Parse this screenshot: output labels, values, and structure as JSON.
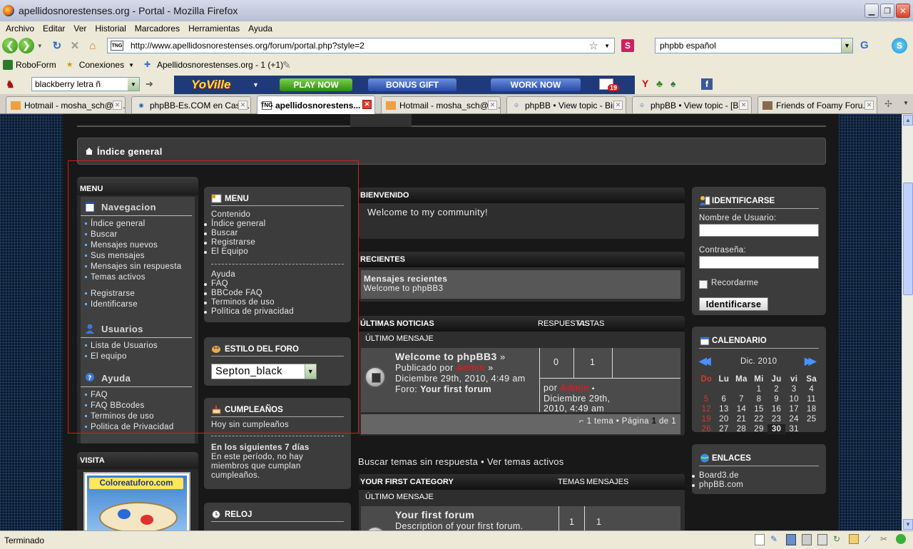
{
  "window": {
    "title": "apellidosnorestenses.org - Portal - Mozilla Firefox"
  },
  "menubar": [
    "Archivo",
    "Editar",
    "Ver",
    "Historial",
    "Marcadores",
    "Herramientas",
    "Ayuda"
  ],
  "navbar": {
    "url": "http://www.apellidosnorestenses.org/forum/portal.php?style=2",
    "url_favicon_text": "TNG",
    "search_value": "phpbb español"
  },
  "bookmarks": [
    {
      "label": "RoboForm",
      "icon": "roboform-icon"
    },
    {
      "label": "Conexiones",
      "icon": "star-icon"
    },
    {
      "label": "Apellidosnorestenses.org - 1 (+1)",
      "icon": "rss-icon"
    }
  ],
  "toolbar3": {
    "search_value": "blackberry letra ñ",
    "yoville_logo": "YoVille",
    "buttons": [
      "PLAY NOW",
      "BONUS GIFT",
      "WORK NOW"
    ],
    "mail_count": "19"
  },
  "tabs": [
    {
      "label": "Hotmail - mosha_sch@h...",
      "active": false
    },
    {
      "label": "phpBB-Es.COM en Cast...",
      "active": false
    },
    {
      "label": "apellidosnorestens...",
      "active": true
    },
    {
      "label": "Hotmail - mosha_sch@h...",
      "active": false
    },
    {
      "label": "phpBB • View topic - Bir...",
      "active": false
    },
    {
      "label": "phpBB • View topic - [B...",
      "active": false
    },
    {
      "label": "Friends of Foamy Foru...",
      "active": false
    }
  ],
  "statusbar": {
    "text": "Terminado"
  },
  "forum": {
    "breadcrumb": "Índice general",
    "left_menu": {
      "header": "MENU",
      "navegacion": {
        "title": "Navegacion",
        "items": [
          "Índice general",
          "Buscar",
          "Mensajes nuevos",
          "Sus mensajes",
          "Mensajes sin respuesta",
          "Temas activos"
        ],
        "items2": [
          "Registrarse",
          "Identificarse"
        ]
      },
      "usuarios": {
        "title": "Usuarios",
        "items": [
          "Lista de Usuarios",
          "El equipo"
        ]
      },
      "ayuda": {
        "title": "Ayuda",
        "items": [
          "FAQ",
          "FAQ BBcodes",
          "Terminos de uso",
          "Politica de Privacidad"
        ]
      }
    },
    "visita": {
      "header": "VISITA",
      "badge": "Coloreatuforo.com"
    },
    "menu2": {
      "header": "MENU",
      "contenido": "Contenido",
      "items1": [
        "Índice general",
        "Buscar",
        "Registrarse",
        "El Equipo"
      ],
      "ayuda": "Ayuda",
      "items2": [
        "FAQ",
        "BBCode FAQ",
        "Terminos de uso",
        "Política de privacidad"
      ]
    },
    "estilo": {
      "header": "ESTILO DEL FORO",
      "selected": "Septon_black"
    },
    "cumple": {
      "header": "CUMPLEAÑOS",
      "hoy": "Hoy sin cumpleaños",
      "next_title": "En los siguientes 7 días",
      "next_text": "En este período, no hay miembros que cumplan cumpleaños."
    },
    "reloj": {
      "header": "RELOJ"
    },
    "bienvenido": {
      "header": "BIENVENIDO",
      "text": "Welcome to my community!"
    },
    "recientes": {
      "header": "RECIENTES",
      "title": "Mensajes recientes",
      "item": "Welcome to phpBB3"
    },
    "noticias": {
      "header": "ÚLTIMAS NOTICIAS",
      "col_respuestas": "RESPUESTAS",
      "col_vistas": "VISTAS",
      "col_ultimo": "ÚLTIMO MENSAJE",
      "topic_title": "Welcome to phpBB3",
      "topic_arrow": "»",
      "publicado": "Publicado por",
      "author": "Admin",
      "date": "Diciembre 29th, 2010, 4:49 am",
      "foro_label": "Foro:",
      "foro_name": "Your first forum",
      "respuestas": "0",
      "vistas": "1",
      "last_por": "por",
      "last_author": "Admin",
      "last_date": "Diciembre 29th, 2010, 4:49 am",
      "pager_pre": "1 tema • Página",
      "pager_cur": "1",
      "pager_de": "de",
      "pager_tot": "1"
    },
    "links_line": "Buscar temas sin respuesta • Ver temas activos",
    "firstcat": {
      "header": "YOUR FIRST CATEGORY",
      "col_temas": "TEMAS",
      "col_mensajes": "MENSAJES",
      "col_ultimo": "ÚLTIMO MENSAJE",
      "forum_title": "Your first forum",
      "forum_desc": "Description of your first forum.",
      "temas": "1",
      "mensajes": "1"
    },
    "login": {
      "header": "IDENTIFICARSE",
      "user_label": "Nombre de Usuario:",
      "pass_label": "Contraseña:",
      "remember": "Recordarme",
      "button": "Identificarse"
    },
    "calendario": {
      "header": "CALENDARIO",
      "month": "Dic. 2010",
      "weekdays": [
        "Do",
        "Lu",
        "Ma",
        "Mi",
        "Ju",
        "vi",
        "Sa"
      ],
      "weeks": [
        [
          "",
          "",
          "",
          "1",
          "2",
          "3",
          "4"
        ],
        [
          "5",
          "6",
          "7",
          "8",
          "9",
          "10",
          "11"
        ],
        [
          "12",
          "13",
          "14",
          "15",
          "16",
          "17",
          "18"
        ],
        [
          "19",
          "20",
          "21",
          "22",
          "23",
          "24",
          "25"
        ],
        [
          "26",
          "27",
          "28",
          "29",
          "30",
          "31",
          ""
        ]
      ],
      "today": "30"
    },
    "enlaces": {
      "header": "ENLACES",
      "items": [
        "Board3.de",
        "phpBB.com"
      ]
    }
  }
}
